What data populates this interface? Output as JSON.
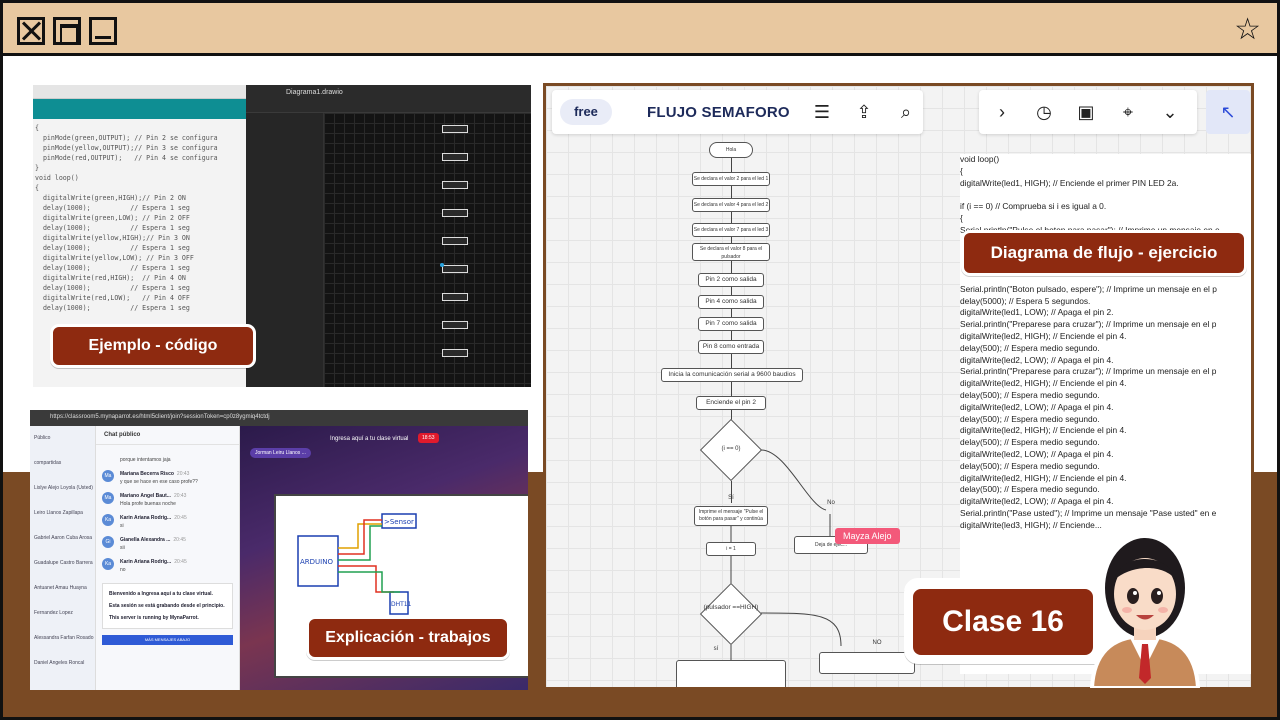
{
  "window": {
    "close_icon": "close-icon",
    "maximize_icon": "maximize-icon",
    "minimize_icon": "minimize-icon",
    "star_icon": "star-icon",
    "star_glyph": "☆"
  },
  "colors": {
    "frame": "#e8c8a0",
    "band": "#7a4a24",
    "label_bg": "#8e2a10",
    "label_text": "#ffffff"
  },
  "labels": {
    "code": "Ejemplo - código",
    "explanation": "Explicación - trabajos",
    "flow": "Diagrama de flujo - ejercicio",
    "class": "Clase 16"
  },
  "code_panel": {
    "lines": [
      "{",
      "  pinMode(green,OUTPUT); // Pin 2 se configura",
      "  pinMode(yellow,OUTPUT);// Pin 3 se configura",
      "  pinMode(red,OUTPUT);   // Pin 4 se configura",
      "}",
      "void loop()",
      "{",
      "  digitalWrite(green,HIGH);// Pin 2 ON",
      "  delay(1000);          // Espera 1 seg",
      "  digitalWrite(green,LOW); // Pin 2 OFF",
      "  delay(1000);          // Espera 1 seg",
      "  digitalWrite(yellow,HIGH);// Pin 3 ON",
      "  delay(1000);          // Espera 1 seg",
      "  digitalWrite(yellow,LOW); // Pin 3 OFF",
      "  delay(1000);          // Espera 1 seg",
      "  digitalWrite(red,HIGH);  // Pin 4 ON",
      "  delay(1000);          // Espera 1 seg",
      "  digitalWrite(red,LOW);   // Pin 4 OFF",
      "  delay(1000);          // Espera 1 seg"
    ],
    "drawio_title": "Diagrama1.drawio"
  },
  "chat_panel": {
    "url": "https://classroom5.mynaparrot.es/html5client/join?sessionToken=cp0z8ygmiq4tctdj",
    "sidebar_items": [
      "Público",
      "compartidas",
      "Lislye Alejo Loyola (Usted)",
      "Leiro Llanos Zapillapa",
      "Gabriel Aaron Cuba Arosa",
      "Guadalupe Castro Barrera",
      "Antuanet Amau Huayna",
      "Fernandez Lopez",
      "Alessandra Farfan Rosado",
      "Daniel Angeles Roncal"
    ],
    "chat_title": "Chat público",
    "messages": [
      {
        "initials": "",
        "name": "",
        "text": "porque intentamos jaja",
        "time": ""
      },
      {
        "initials": "Ma",
        "name": "Mariana Becerra Risco",
        "text": "y que se hace en ese caso profe??",
        "time": "20:43"
      },
      {
        "initials": "Ma",
        "name": "Mariano Angel Baut...",
        "text": "Hola profe buenas noche",
        "time": "20:43"
      },
      {
        "initials": "Ka",
        "name": "Karin Ariana Rodrig...",
        "text": "si",
        "time": "20:45"
      },
      {
        "initials": "Gi",
        "name": "Gianella Alexandra ...",
        "text": "sii",
        "time": "20:45"
      },
      {
        "initials": "Ka",
        "name": "Karin Ariana Rodrig...",
        "text": "no",
        "time": "20:45"
      }
    ],
    "welcome": [
      "Bienvenido a Ingresa aquí a tu clase virtual.",
      "Esta sesión se está grabando desde el principio.",
      "This server is running by MynaParrot."
    ],
    "welcome_button": "MÁS MENSAJES ABAJO",
    "video_title": "Ingresa aquí a tu clase virtual",
    "rec_time": "18:53",
    "presenter": "Jorman Leiru Llanos ..."
  },
  "flow_panel": {
    "logo": "free",
    "title": "FLUJO SEMAFORO",
    "menu_icon": "☰",
    "share_icon": "⇪",
    "search_icon": "⌕",
    "chevron_icon": "›",
    "timer_icon": "◷",
    "present_icon": "▣",
    "focus_icon": "⌖",
    "more_icon": "⌄",
    "cursor_icon": "↖",
    "nodes": {
      "start": "Hola",
      "n1": "Se declara el valor 2 para el led 1",
      "n2": "Se declara el valor 4 para el led 2",
      "n3": "Se declara el valor 7 para el led 3",
      "n4": "Se declara el valor 8 para el pulsador",
      "n5": "Pin 2 como salida",
      "n6": "Pin 4 como salida",
      "n7": "Pin 7 como salida",
      "n8": "Pin 8 como entrada",
      "n9": "Inicia la comunicación serial a 9600 baudios",
      "n10": "Enciende el pin 2",
      "d1": "(i == 0)",
      "si1": "Sí",
      "no1": "No",
      "n11": "Imprime el mensaje \"Pulse el botón para pasar\" y continúa",
      "n12": "i = 1",
      "n13": "Deja de ejec...",
      "d2": "(pulsador ==HIGH)",
      "no2": "NO",
      "si2": "sí"
    },
    "cursor_user": "Mayza Alejo",
    "text_lines": [
      "void loop()",
      "{",
      "  digitalWrite(led1, HIGH); // Enciende el primer PIN LED 2a.",
      "",
      "  if (i == 0) // Comprueba si i es igual a 0.",
      "  {",
      "    Serial.println(\"Pulse el boton para pasar\"); // Imprime un mensaje en e",
      "",
      "",
      "",
      "",
      "    Serial.println(\"Boton pulsado, espere\"); // Imprime un mensaje en el p",
      "    delay(5000); // Espera 5 segundos.",
      "    digitalWrite(led1, LOW); // Apaga el pin 2.",
      "    Serial.println(\"Preparese para cruzar\"); // Imprime un mensaje en el p",
      "    digitalWrite(led2, HIGH); // Enciende el pin 4.",
      "    delay(500); // Espera medio segundo.",
      "digitalWrite(led2, LOW); // Apaga el pin 4.",
      "Serial.println(\"Preparese para cruzar\"); // Imprime un mensaje en el p",
      "digitalWrite(led2, HIGH); // Enciende el pin 4.",
      "delay(500); // Espera medio segundo.",
      "digitalWrite(led2, LOW); // Apaga el pin 4.",
      "delay(500); // Espera medio segundo.",
      "digitalWrite(led2, HIGH); // Enciende el pin 4.",
      "delay(500); // Espera medio segundo.",
      "digitalWrite(led2, LOW); // Apaga el pin 4.",
      "delay(500); // Espera medio segundo.",
      "digitalWrite(led2, HIGH); // Enciende el pin 4.",
      "delay(500); // Espera medio segundo.",
      "digitalWrite(led2, LOW); // Apaga el pin 4.",
      "Serial.println(\"Pase usted\"); // Imprime un mensaje \"Pase usted\" en e",
      "digitalWrite(led3, HIGH); // Enciende..."
    ]
  }
}
